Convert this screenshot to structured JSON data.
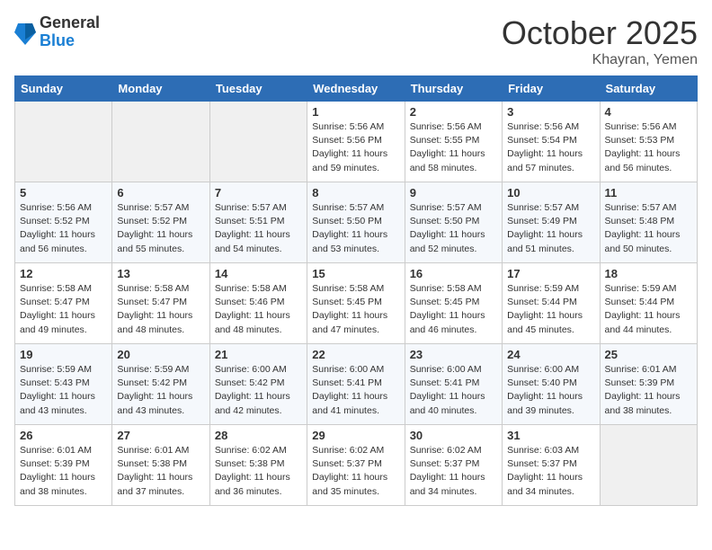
{
  "logo": {
    "general": "General",
    "blue": "Blue"
  },
  "header": {
    "month": "October 2025",
    "location": "Khayran, Yemen"
  },
  "weekdays": [
    "Sunday",
    "Monday",
    "Tuesday",
    "Wednesday",
    "Thursday",
    "Friday",
    "Saturday"
  ],
  "weeks": [
    [
      {
        "day": "",
        "empty": true
      },
      {
        "day": "",
        "empty": true
      },
      {
        "day": "",
        "empty": true
      },
      {
        "day": "1",
        "sunrise": "5:56 AM",
        "sunset": "5:56 PM",
        "daylight": "11 hours and 59 minutes."
      },
      {
        "day": "2",
        "sunrise": "5:56 AM",
        "sunset": "5:55 PM",
        "daylight": "11 hours and 58 minutes."
      },
      {
        "day": "3",
        "sunrise": "5:56 AM",
        "sunset": "5:54 PM",
        "daylight": "11 hours and 57 minutes."
      },
      {
        "day": "4",
        "sunrise": "5:56 AM",
        "sunset": "5:53 PM",
        "daylight": "11 hours and 56 minutes."
      }
    ],
    [
      {
        "day": "5",
        "sunrise": "5:56 AM",
        "sunset": "5:52 PM",
        "daylight": "11 hours and 56 minutes."
      },
      {
        "day": "6",
        "sunrise": "5:57 AM",
        "sunset": "5:52 PM",
        "daylight": "11 hours and 55 minutes."
      },
      {
        "day": "7",
        "sunrise": "5:57 AM",
        "sunset": "5:51 PM",
        "daylight": "11 hours and 54 minutes."
      },
      {
        "day": "8",
        "sunrise": "5:57 AM",
        "sunset": "5:50 PM",
        "daylight": "11 hours and 53 minutes."
      },
      {
        "day": "9",
        "sunrise": "5:57 AM",
        "sunset": "5:50 PM",
        "daylight": "11 hours and 52 minutes."
      },
      {
        "day": "10",
        "sunrise": "5:57 AM",
        "sunset": "5:49 PM",
        "daylight": "11 hours and 51 minutes."
      },
      {
        "day": "11",
        "sunrise": "5:57 AM",
        "sunset": "5:48 PM",
        "daylight": "11 hours and 50 minutes."
      }
    ],
    [
      {
        "day": "12",
        "sunrise": "5:58 AM",
        "sunset": "5:47 PM",
        "daylight": "11 hours and 49 minutes."
      },
      {
        "day": "13",
        "sunrise": "5:58 AM",
        "sunset": "5:47 PM",
        "daylight": "11 hours and 48 minutes."
      },
      {
        "day": "14",
        "sunrise": "5:58 AM",
        "sunset": "5:46 PM",
        "daylight": "11 hours and 48 minutes."
      },
      {
        "day": "15",
        "sunrise": "5:58 AM",
        "sunset": "5:45 PM",
        "daylight": "11 hours and 47 minutes."
      },
      {
        "day": "16",
        "sunrise": "5:58 AM",
        "sunset": "5:45 PM",
        "daylight": "11 hours and 46 minutes."
      },
      {
        "day": "17",
        "sunrise": "5:59 AM",
        "sunset": "5:44 PM",
        "daylight": "11 hours and 45 minutes."
      },
      {
        "day": "18",
        "sunrise": "5:59 AM",
        "sunset": "5:44 PM",
        "daylight": "11 hours and 44 minutes."
      }
    ],
    [
      {
        "day": "19",
        "sunrise": "5:59 AM",
        "sunset": "5:43 PM",
        "daylight": "11 hours and 43 minutes."
      },
      {
        "day": "20",
        "sunrise": "5:59 AM",
        "sunset": "5:42 PM",
        "daylight": "11 hours and 43 minutes."
      },
      {
        "day": "21",
        "sunrise": "6:00 AM",
        "sunset": "5:42 PM",
        "daylight": "11 hours and 42 minutes."
      },
      {
        "day": "22",
        "sunrise": "6:00 AM",
        "sunset": "5:41 PM",
        "daylight": "11 hours and 41 minutes."
      },
      {
        "day": "23",
        "sunrise": "6:00 AM",
        "sunset": "5:41 PM",
        "daylight": "11 hours and 40 minutes."
      },
      {
        "day": "24",
        "sunrise": "6:00 AM",
        "sunset": "5:40 PM",
        "daylight": "11 hours and 39 minutes."
      },
      {
        "day": "25",
        "sunrise": "6:01 AM",
        "sunset": "5:39 PM",
        "daylight": "11 hours and 38 minutes."
      }
    ],
    [
      {
        "day": "26",
        "sunrise": "6:01 AM",
        "sunset": "5:39 PM",
        "daylight": "11 hours and 38 minutes."
      },
      {
        "day": "27",
        "sunrise": "6:01 AM",
        "sunset": "5:38 PM",
        "daylight": "11 hours and 37 minutes."
      },
      {
        "day": "28",
        "sunrise": "6:02 AM",
        "sunset": "5:38 PM",
        "daylight": "11 hours and 36 minutes."
      },
      {
        "day": "29",
        "sunrise": "6:02 AM",
        "sunset": "5:37 PM",
        "daylight": "11 hours and 35 minutes."
      },
      {
        "day": "30",
        "sunrise": "6:02 AM",
        "sunset": "5:37 PM",
        "daylight": "11 hours and 34 minutes."
      },
      {
        "day": "31",
        "sunrise": "6:03 AM",
        "sunset": "5:37 PM",
        "daylight": "11 hours and 34 minutes."
      },
      {
        "day": "",
        "empty": true
      }
    ]
  ],
  "labels": {
    "sunrise": "Sunrise:",
    "sunset": "Sunset:",
    "daylight": "Daylight:"
  }
}
